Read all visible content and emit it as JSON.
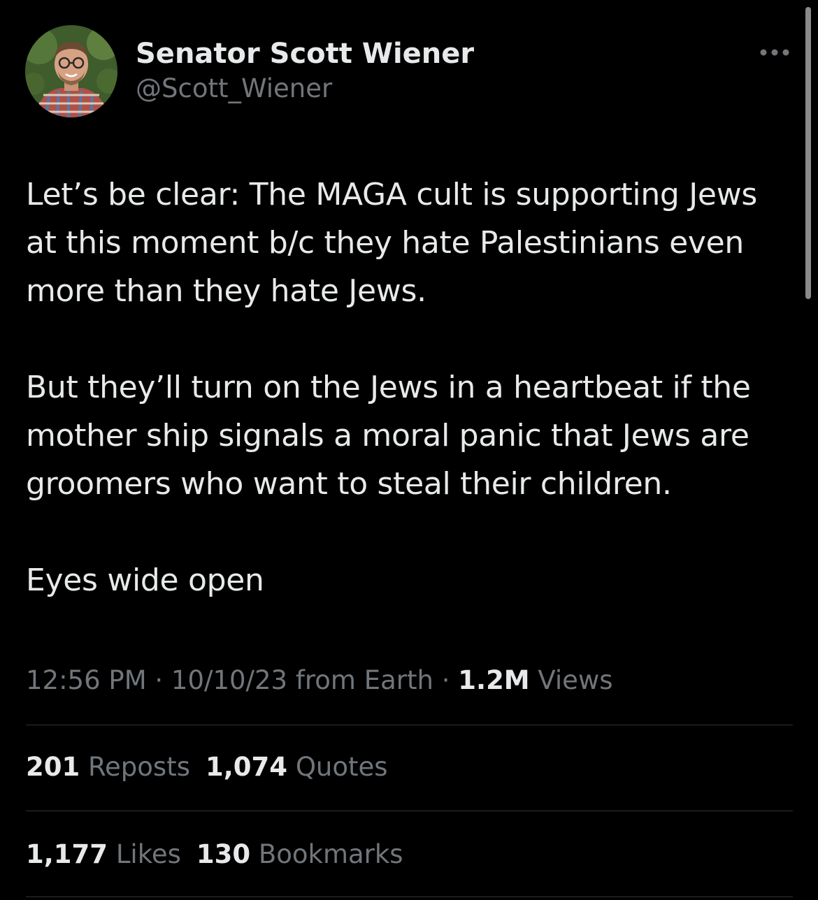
{
  "author": {
    "display_name": "Senator Scott Wiener",
    "handle": "@Scott_Wiener"
  },
  "tweet": {
    "paragraphs": [
      "Let’s be clear: The MAGA cult is supporting Jews at this moment b/c they hate Palestinians even more than they hate Jews.",
      "But they’ll turn on the Jews in a heartbeat if the mother ship signals a moral panic that Jews are groomers who want to steal their children.",
      "Eyes wide open"
    ],
    "time": "12:56 PM",
    "date": "10/10/23",
    "source": "from Earth",
    "separator": "·",
    "views_count": "1.2M",
    "views_label": "Views"
  },
  "stats": {
    "reposts_count": "201",
    "reposts_label": "Reposts",
    "quotes_count": "1,074",
    "quotes_label": "Quotes",
    "likes_count": "1,177",
    "likes_label": "Likes",
    "bookmarks_count": "130",
    "bookmarks_label": "Bookmarks"
  },
  "icons": {
    "more": "more-horizontal-icon"
  },
  "colors": {
    "background": "#000000",
    "primary_text": "#e7e9ea",
    "secondary_text": "#71767b",
    "divider": "#2f3336"
  }
}
